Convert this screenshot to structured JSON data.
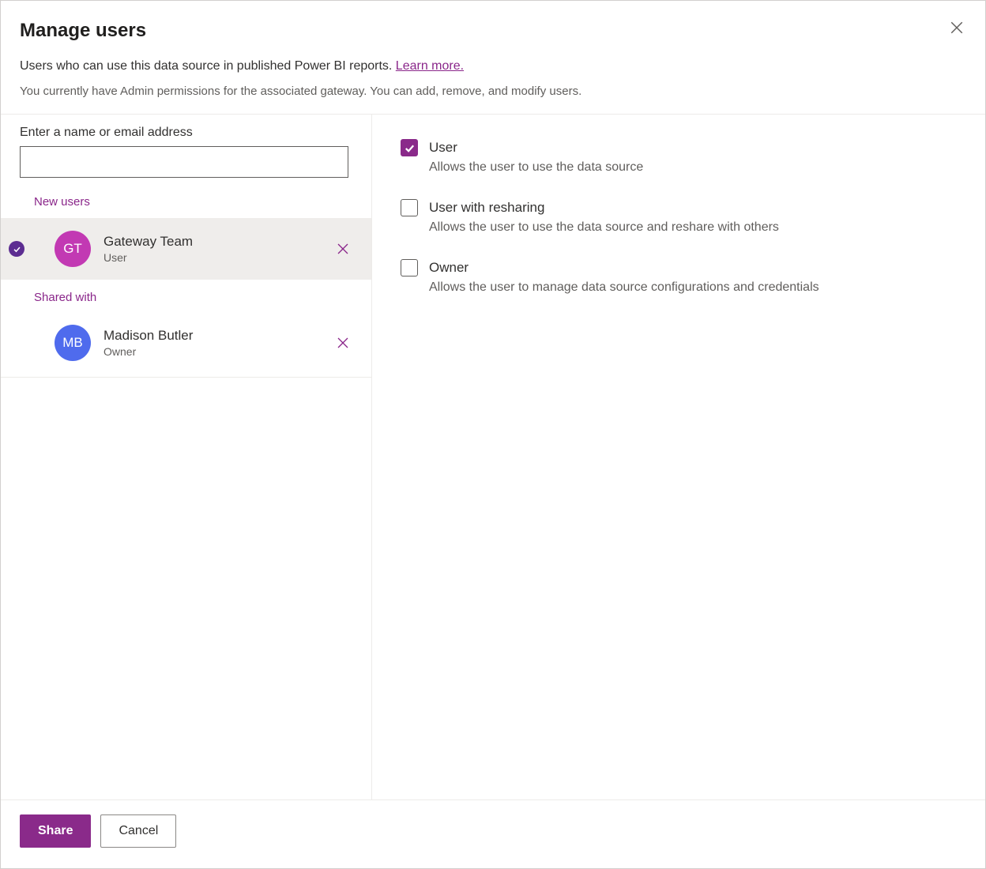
{
  "dialog": {
    "title": "Manage users",
    "description": "Users who can use this data source in published Power BI reports. ",
    "learn_more": "Learn more.",
    "permission_note": "You currently have Admin permissions for the associated gateway. You can add, remove, and modify users."
  },
  "left": {
    "search_label": "Enter a name or email address",
    "search_value": "",
    "new_users_header": "New users",
    "shared_with_header": "Shared with",
    "new_users": [
      {
        "initials": "GT",
        "name": "Gateway Team",
        "role": "User",
        "avatar_color": "magenta",
        "selected": true
      }
    ],
    "shared_with": [
      {
        "initials": "MB",
        "name": "Madison Butler",
        "role": "Owner",
        "avatar_color": "blue",
        "selected": false
      }
    ]
  },
  "right": {
    "options": [
      {
        "label": "User",
        "desc": "Allows the user to use the data source",
        "checked": true
      },
      {
        "label": "User with resharing",
        "desc": "Allows the user to use the data source and reshare with others",
        "checked": false
      },
      {
        "label": "Owner",
        "desc": "Allows the user to manage data source configurations and credentials",
        "checked": false
      }
    ]
  },
  "footer": {
    "share": "Share",
    "cancel": "Cancel"
  }
}
